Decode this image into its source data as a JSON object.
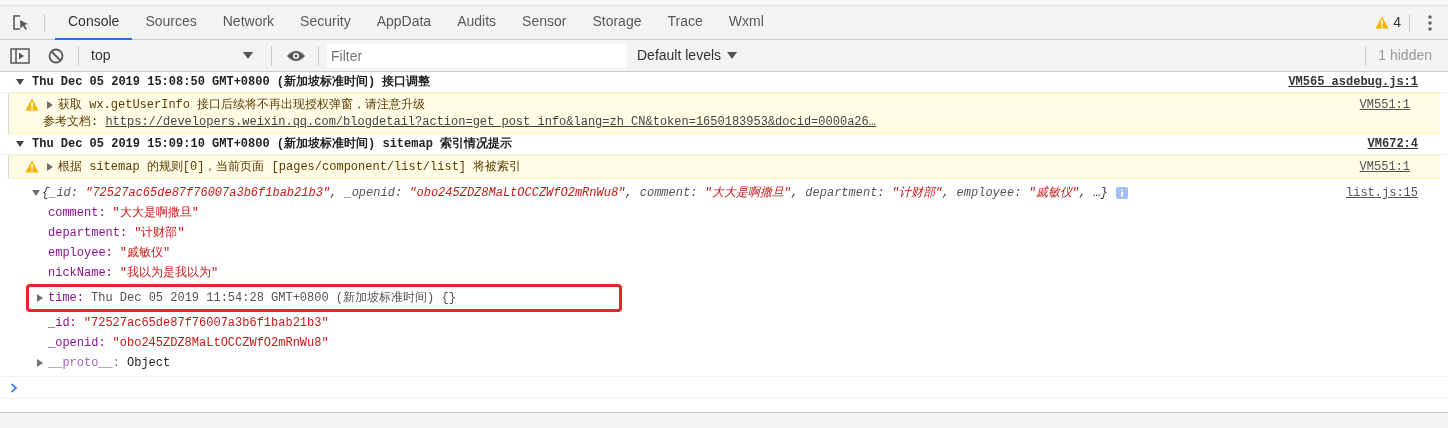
{
  "tabs": [
    {
      "label": "Console",
      "selected": true
    },
    {
      "label": "Sources",
      "selected": false
    },
    {
      "label": "Network",
      "selected": false
    },
    {
      "label": "Security",
      "selected": false
    },
    {
      "label": "AppData",
      "selected": false
    },
    {
      "label": "Audits",
      "selected": false
    },
    {
      "label": "Sensor",
      "selected": false
    },
    {
      "label": "Storage",
      "selected": false
    },
    {
      "label": "Trace",
      "selected": false
    },
    {
      "label": "Wxml",
      "selected": false
    }
  ],
  "warning_count": "4",
  "toolbar": {
    "context": "top",
    "filter_placeholder": "Filter",
    "levels": "Default levels",
    "hidden": "1 hidden"
  },
  "messages": [
    {
      "kind": "group",
      "expanded": true,
      "text": "Thu Dec 05 2019 15:08:50 GMT+0800 (新加坡标准时间) 接口调整",
      "source": "VM565 asdebug.js:1"
    },
    {
      "kind": "warning",
      "expanded": false,
      "text": "获取 wx.getUserInfo 接口后续将不再出现授权弹窗，请注意升级",
      "doc_label": "参考文档: ",
      "doc_link": "https://developers.weixin.qq.com/blogdetail?action=get_post_info&lang=zh_CN&token=1650183953&docid=0000a26…",
      "source": "VM551:1"
    },
    {
      "kind": "group",
      "expanded": true,
      "text": "Thu Dec 05 2019 15:09:10 GMT+0800 (新加坡标准时间) sitemap 索引情况提示",
      "source": "VM672:4"
    },
    {
      "kind": "warning",
      "expanded": false,
      "text": "根据 sitemap 的规则[0]，当前页面 [pages/component/list/list] 将被索引",
      "source": "VM551:1"
    },
    {
      "kind": "object",
      "expanded": true,
      "summary": [
        {
          "kind": "punct",
          "text": "{"
        },
        {
          "kind": "key",
          "text": "_id: "
        },
        {
          "kind": "value",
          "text": "\"72527ac65de87f76007a3b6f1bab21b3\""
        },
        {
          "kind": "punct",
          "text": ", "
        },
        {
          "kind": "key",
          "text": "_openid: "
        },
        {
          "kind": "value",
          "text": "\"obo245ZDZ8MaLtOCCZWfO2mRnWu8\""
        },
        {
          "kind": "punct",
          "text": ", "
        },
        {
          "kind": "key",
          "text": "comment: "
        },
        {
          "kind": "value",
          "text": "\"大大是啊撒旦\""
        },
        {
          "kind": "punct",
          "text": ", "
        },
        {
          "kind": "key",
          "text": "department: "
        },
        {
          "kind": "value",
          "text": "\"计财部\""
        },
        {
          "kind": "punct",
          "text": ", "
        },
        {
          "kind": "key",
          "text": "employee: "
        },
        {
          "kind": "value",
          "text": "\"戚敏仪\""
        },
        {
          "kind": "punct",
          "text": ", …}"
        }
      ],
      "source": "list.js:15",
      "properties": [
        {
          "kind": "string",
          "key": "comment:",
          "value": "\"大大是啊撒旦\"",
          "highlighted": false
        },
        {
          "kind": "string",
          "key": "department:",
          "value": "\"计财部\"",
          "highlighted": false
        },
        {
          "kind": "string",
          "key": "employee:",
          "value": "\"戚敏仪\"",
          "highlighted": false
        },
        {
          "kind": "string",
          "key": "nickName:",
          "value": "\"我以为是我以为\"",
          "highlighted": false
        },
        {
          "kind": "expandable",
          "key": "time:",
          "value": "Thu Dec 05 2019 11:54:28 GMT+0800 (新加坡标准时间) {}",
          "expanded": false,
          "highlighted": true
        },
        {
          "kind": "string",
          "key": "_id:",
          "value": "\"72527ac65de87f76007a3b6f1bab21b3\"",
          "highlighted": false
        },
        {
          "kind": "string",
          "key": "_openid:",
          "value": "\"obo245ZDZ8MaLtOCCZWfO2mRnWu8\"",
          "highlighted": false
        },
        {
          "kind": "proto",
          "key": "__proto__:",
          "value": "Object",
          "expanded": false,
          "highlighted": false
        }
      ]
    }
  ]
}
